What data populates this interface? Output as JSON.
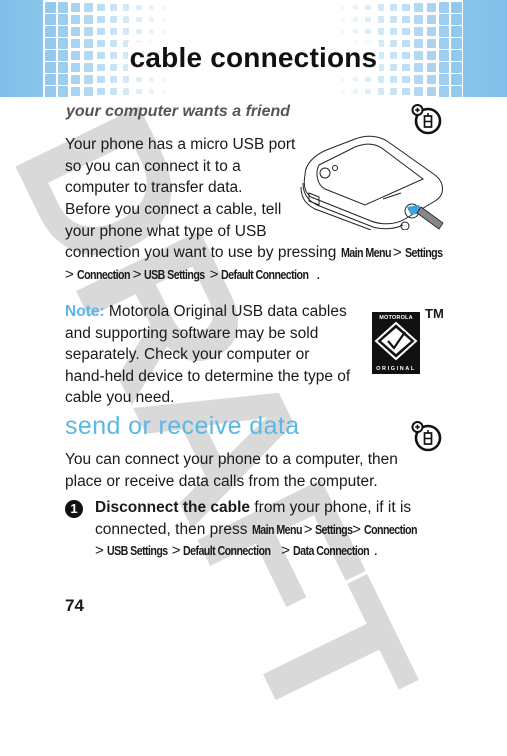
{
  "header": {
    "title": "cable connections",
    "band_color": "#7fbfe9"
  },
  "watermark": {
    "text": "DRAFT",
    "color": "#d9d9d9"
  },
  "section1": {
    "subhead": "your computer wants a friend",
    "icon": "feature-phone-plus-icon",
    "para1_lines": [
      "Your phone has a micro USB port",
      "so you can connect it to a",
      "computer to transfer data."
    ],
    "para2_lines": [
      "Before you connect a cable, tell",
      "your phone what type of USB"
    ],
    "para2_tail": "connection you want to use by pressing",
    "para2_path": [
      "Main Menu",
      "Settings",
      "Connection",
      "USB Settings",
      "Default Connection"
    ],
    "separator": ">",
    "period": ".",
    "illustration": "phone-usb-illustration"
  },
  "note": {
    "label": "Note:",
    "lines": [
      "Motorola Original USB data cables",
      "and supporting software may be sold",
      "separately. Check your computer or",
      "hand-held device to determine the type of",
      "cable you need."
    ],
    "logo": {
      "top_text": "MOTOROLA",
      "bottom_text": "ORIGINAL",
      "tm": "TM"
    }
  },
  "section2": {
    "title": "send or receive data",
    "accent_color": "#5bb8e6",
    "icon": "feature-phone-plus-icon",
    "intro_lines": [
      "You can connect your phone to a computer, then",
      "place or receive data calls from the computer."
    ],
    "steps": [
      {
        "number": "1",
        "bold": "Disconnect the cable",
        "text": "from your phone, if it is",
        "line2": "connected, then press",
        "path": [
          "Main Menu",
          "Settings",
          "Connection",
          "USB Settings",
          "Default Connection",
          "Data Connection"
        ]
      }
    ]
  },
  "page_number": "74"
}
